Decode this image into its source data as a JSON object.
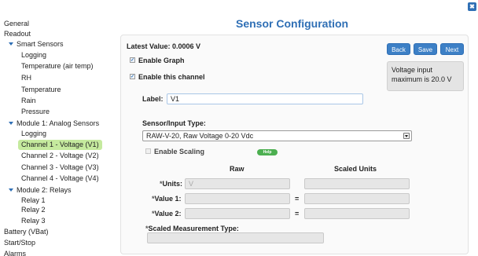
{
  "window": {
    "title": "Sensor Configuration",
    "close_label": "✖"
  },
  "sidebar": {
    "items": [
      {
        "label": "General",
        "level": 0
      },
      {
        "label": "Readout",
        "level": 0
      },
      {
        "label": "Smart Sensors",
        "level": 1,
        "expanded": true
      },
      {
        "label": "Logging",
        "level": 2
      },
      {
        "label": "Temperature (air temp)",
        "level": 2
      },
      {
        "label": "RH",
        "level": 2
      },
      {
        "label": "Temperature",
        "level": 2
      },
      {
        "label": "Rain",
        "level": 2
      },
      {
        "label": "Pressure",
        "level": 2
      },
      {
        "label": "Module 1: Analog Sensors",
        "level": 1,
        "expanded": true
      },
      {
        "label": "Logging",
        "level": 2
      },
      {
        "label": "Channel 1 - Voltage (V1)",
        "level": 2,
        "selected": true
      },
      {
        "label": "Channel 2 - Voltage (V2)",
        "level": 2
      },
      {
        "label": "Channel 3 - Voltage (V3)",
        "level": 2
      },
      {
        "label": "Channel 4 - Voltage (V4)",
        "level": 2
      },
      {
        "label": "Module 2: Relays",
        "level": 1,
        "expanded": true
      },
      {
        "label": "Relay 1",
        "level": 2
      },
      {
        "label": "Relay 2",
        "level": 2
      },
      {
        "label": "Relay 3",
        "level": 2
      },
      {
        "label": "Battery (VBat)",
        "level": 0
      },
      {
        "label": "Start/Stop",
        "level": 0
      },
      {
        "label": "Alarms",
        "level": 0
      }
    ],
    "highlight_color": "#c5ea9e"
  },
  "panel": {
    "latest_value": "Latest Value: 0.0006 V",
    "enable_graph": {
      "label": "Enable Graph",
      "checked": true
    },
    "enable_channel": {
      "label": "Enable this channel",
      "checked": true
    },
    "buttons": {
      "back": "Back",
      "save": "Save",
      "next": "Next"
    },
    "note": "Voltage input maximum is 20.0 V",
    "label_field": {
      "label": "Label:",
      "value": "V1"
    },
    "sensor_type": {
      "label": "Sensor/Input Type:",
      "selected": "RAW-V-20, Raw Voltage 0-20 Vdc"
    },
    "enable_scaling": {
      "label": "Enable Scaling",
      "checked": false
    },
    "help_label": "Help",
    "columns": {
      "raw": "Raw",
      "scaled": "Scaled Units"
    },
    "rows": {
      "units": {
        "label": "Units:",
        "required_mark": "*",
        "raw_value": "V",
        "scaled_value": ""
      },
      "value1": {
        "label": "Value 1:",
        "required_mark": "*",
        "raw_value": "",
        "scaled_value": "",
        "equals": "="
      },
      "value2": {
        "label": "Value 2:",
        "required_mark": "*",
        "raw_value": "",
        "scaled_value": "",
        "equals": "="
      }
    },
    "scaled_measurement_type": {
      "label": "Scaled Measurement Type:",
      "required_mark": "*",
      "value": ""
    }
  },
  "colors": {
    "accent": "#2f6fb5",
    "button": "#3d80c6",
    "help": "#4caf50"
  }
}
